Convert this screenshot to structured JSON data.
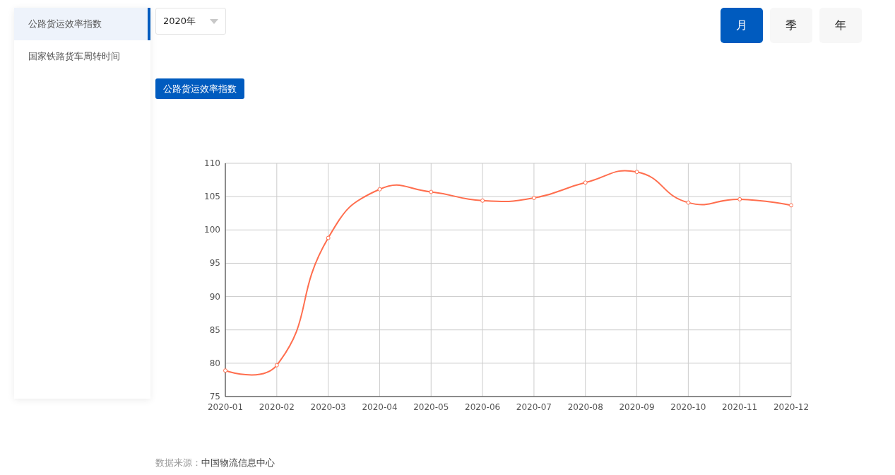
{
  "sidebar": {
    "items": [
      {
        "label": "公路货运效率指数",
        "selected": true
      },
      {
        "label": "国家铁路货车周转时间",
        "selected": false
      }
    ]
  },
  "year_select": {
    "value": "2020年"
  },
  "period_tabs": [
    {
      "label": "月",
      "selected": true
    },
    {
      "label": "季",
      "selected": false
    },
    {
      "label": "年",
      "selected": false
    }
  ],
  "chart_data": {
    "type": "line",
    "grid": true,
    "categories": [
      "2020-01",
      "2020-02",
      "2020-03",
      "2020-04",
      "2020-05",
      "2020-06",
      "2020-07",
      "2020-08",
      "2020-09",
      "2020-10",
      "2020-11",
      "2020-12"
    ],
    "ylim": [
      75,
      110
    ],
    "yticks": [
      75,
      80,
      85,
      90,
      95,
      100,
      105,
      110
    ],
    "series": [
      {
        "name": "公路货运效率指数",
        "color": "#ff6e4e",
        "marker": "circle",
        "values": [
          78.9,
          79.7,
          98.8,
          106.1,
          105.7,
          104.4,
          104.8,
          107.1,
          108.7,
          104.1,
          104.6,
          103.7
        ]
      }
    ]
  },
  "source": {
    "label": "数据来源：",
    "value": "中国物流信息中心"
  }
}
